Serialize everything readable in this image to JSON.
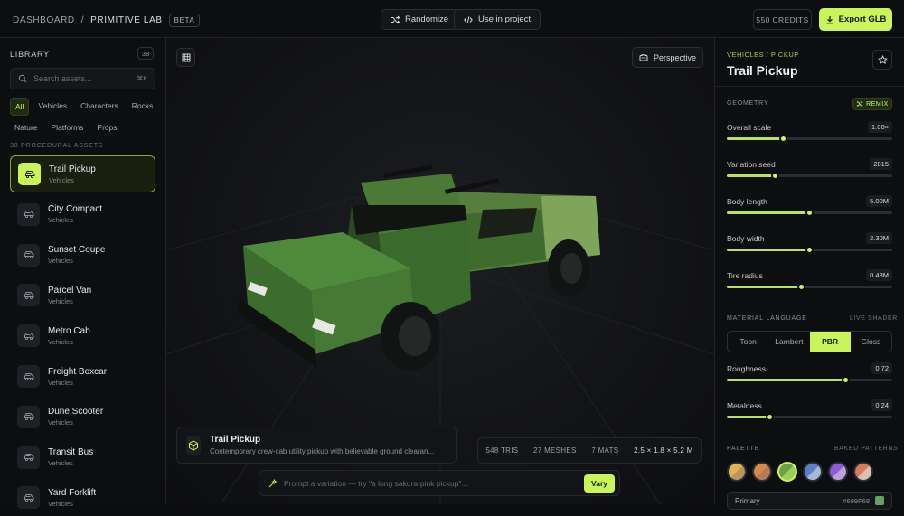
{
  "topbar": {
    "crumb_root": "DASHBOARD",
    "crumb_sep": "/",
    "crumb_current": "PRIMITIVE LAB",
    "badge": "BETA",
    "randomize_label": "Randomize",
    "use_in_project_label": "Use in project",
    "credits": "550 CREDITS",
    "export_label": "Export GLB"
  },
  "sidebar": {
    "title": "LIBRARY",
    "count": "38",
    "search_placeholder": "Search assets...",
    "search_shortcut": "⌘K",
    "filters": [
      "All",
      "Vehicles",
      "Characters",
      "Rocks",
      "Nature",
      "Platforms",
      "Props"
    ],
    "active_filter": "All",
    "section_label": "38 PROCEDURAL ASSETS",
    "assets": [
      {
        "name": "Trail Pickup",
        "category": "Vehicles",
        "selected": true
      },
      {
        "name": "City Compact",
        "category": "Vehicles"
      },
      {
        "name": "Sunset Coupe",
        "category": "Vehicles"
      },
      {
        "name": "Parcel Van",
        "category": "Vehicles"
      },
      {
        "name": "Metro Cab",
        "category": "Vehicles"
      },
      {
        "name": "Freight Boxcar",
        "category": "Vehicles"
      },
      {
        "name": "Dune Scooter",
        "category": "Vehicles"
      },
      {
        "name": "Transit Bus",
        "category": "Vehicles"
      },
      {
        "name": "Yard Forklift",
        "category": "Vehicles"
      }
    ]
  },
  "viewport": {
    "camera_label": "Perspective",
    "card_title": "Trail Pickup",
    "card_desc": "Contemporary crew-cab utility pickup with believable ground clearan...",
    "stats": {
      "tris": "548 TRIS",
      "meshes": "27 MESHES",
      "mats": "7 MATS",
      "dims": "2.5 × 1.8 × 5.2 M"
    },
    "prompt_placeholder": "Prompt a variation — try \"a long sakura-pink pickup\"...",
    "vary_label": "Vary"
  },
  "panel": {
    "crumb": "VEHICLES / PICKUP",
    "title": "Trail Pickup",
    "geometry_label": "GEOMETRY",
    "remix_label": "REMIX",
    "geometry": [
      {
        "label": "Overall scale",
        "value": "1.00×",
        "level": 0.34
      },
      {
        "label": "Variation seed",
        "value": "2815",
        "level": 0.29
      },
      {
        "label": "Body length",
        "value": "5.00M",
        "level": 0.5
      },
      {
        "label": "Body width",
        "value": "2.30M",
        "level": 0.5
      },
      {
        "label": "Tire radius",
        "value": "0.48M",
        "level": 0.45
      }
    ],
    "material_label": "MATERIAL LANGUAGE",
    "live_label": "LIVE SHADER",
    "shaders": [
      "Toon",
      "Lambert",
      "PBR",
      "Gloss"
    ],
    "active_shader": "PBR",
    "material": [
      {
        "label": "Roughness",
        "value": "0.72",
        "level": 0.72
      },
      {
        "label": "Metalness",
        "value": "0.24",
        "level": 0.26
      }
    ],
    "palette_label": "PALETTE",
    "baked_label": "BAKED PATTERNS",
    "swatches": [
      {
        "a": "#e0b452",
        "b": "#b9965a"
      },
      {
        "a": "#d9884a",
        "b": "#b87a54"
      },
      {
        "a": "#6aa04a",
        "b": "#9ccf5a",
        "selected": true
      },
      {
        "a": "#5a7fc9",
        "b": "#a7b8d6"
      },
      {
        "a": "#8e5ad6",
        "b": "#b9a0e0"
      },
      {
        "a": "#d67a5a",
        "b": "#d9c0b0"
      }
    ],
    "primary_label": "Primary",
    "primary_hex": "#699F68",
    "primary_color": "#699f68"
  },
  "colors": {
    "accent": "#c9f55b",
    "body_green": "#4f8a3c"
  }
}
